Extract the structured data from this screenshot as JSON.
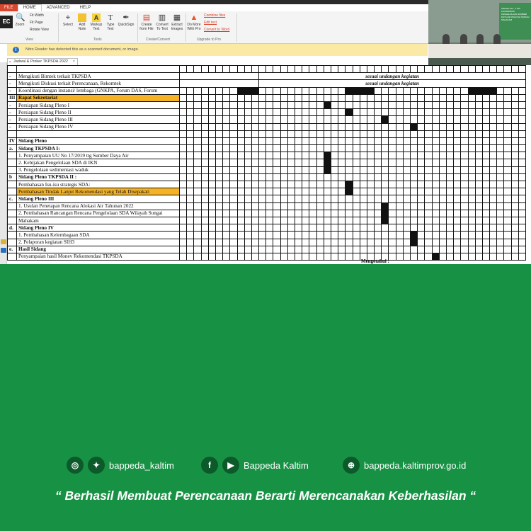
{
  "app": {
    "tabs": [
      "FILE",
      "HOME",
      "ADVANCED",
      "HELP"
    ],
    "ec_label": "EC",
    "ribbon": {
      "zoom_label": "Zoom",
      "fit_width": "Fit Width",
      "fit_page": "Fit Page",
      "rotate_view": "Rotate View",
      "view_group": "View",
      "select_label": "Select",
      "add_note": "Add Note",
      "markup_text": "Markup Text",
      "type_text": "Type Text",
      "quicksign": "QuickSign",
      "tools_group": "Tools",
      "create_from_file": "Create from File",
      "convert_to_text": "Convert To Text",
      "extract_images": "Extract Images",
      "create_convert_group": "Create/Convert",
      "do_more_with_pro": "Do More With Pro",
      "combine_files": "Combine files",
      "edit_text": "Edit text",
      "convert_to_word": "Convert to Word",
      "upgrade_group": "Upgrade to Pro"
    },
    "notice": "Nitro Reader has detected this as a scanned document, or image.",
    "document_tab": "Jadwal & Proker TKPSDA 2022",
    "video_banner": "SIDANG KE - II TIM KOORDINASI PENGELOLAAN SUMBER DAYA AIR WILAYAH SUNGAI MAHAKAM"
  },
  "schedule": {
    "rows": [
      {
        "num": "",
        "text": "",
        "fills": [],
        "note": "",
        "style": ""
      },
      {
        "num": "-",
        "text": "Mengikuti Bimtek terkait TKPSDA",
        "fills": [],
        "note": "sesuai undangan kegiatan",
        "style": ""
      },
      {
        "num": "-",
        "text": "Mengikuti Diskusi terkait Perencanaan, Rekomtek",
        "fills": [],
        "note": "sesuai undangan kegiatan",
        "style": ""
      },
      {
        "num": "-",
        "text": "Koordinasi dengan instansi/ lembaga (GNKPA, Forum DAS, Forum",
        "fills": [
          8,
          9,
          10,
          23,
          24,
          25,
          26,
          40,
          41,
          42,
          43
        ],
        "note": "",
        "style": ""
      },
      {
        "num": "III",
        "text": "Rapat Sekretariat",
        "fills": [],
        "note": "",
        "style": "hl sec"
      },
      {
        "num": "-",
        "text": "Persiapan Sidang Pleno I",
        "fills": [
          20
        ],
        "note": "",
        "style": ""
      },
      {
        "num": "-",
        "text": "Persiapan Sidang Pleno II",
        "fills": [
          23
        ],
        "note": "",
        "style": ""
      },
      {
        "num": "-",
        "text": "Persiapan Sidang Pleno III",
        "fills": [
          28
        ],
        "note": "",
        "style": ""
      },
      {
        "num": "-",
        "text": "Persiapan Sidang Pleno IV",
        "fills": [
          32
        ],
        "note": "",
        "style": ""
      },
      {
        "num": "",
        "text": "",
        "fills": [],
        "note": "",
        "style": ""
      },
      {
        "num": "IV",
        "text": "Sidang Pleno",
        "fills": [],
        "note": "",
        "style": "sec"
      },
      {
        "num": "a.",
        "text": "Sidang TKPSDA I:",
        "fills": [],
        "note": "",
        "style": "sec"
      },
      {
        "num": "",
        "text": "1. Penyampaian UU No 17/2019 ttg Sumber Daya Air",
        "fills": [
          20
        ],
        "note": "",
        "style": ""
      },
      {
        "num": "",
        "text": "2. Kebijakan Pengelolaan SDA di IKN",
        "fills": [
          20
        ],
        "note": "",
        "style": ""
      },
      {
        "num": "",
        "text": "3. Pengelolaan sedimentasi waduk",
        "fills": [
          20
        ],
        "note": "",
        "style": ""
      },
      {
        "num": "b",
        "text": "Sidang Pleno TKPSDA II :",
        "fills": [],
        "note": "",
        "style": "sec"
      },
      {
        "num": "",
        "text": "Pembahasan Isu-isu strategis SDA:",
        "fills": [
          23
        ],
        "note": "",
        "style": ""
      },
      {
        "num": "",
        "text": "Pembahasan Tindak Lanjut Rekomendasi yang Telah Disepakati",
        "fills": [
          23
        ],
        "note": "",
        "style": "hl"
      },
      {
        "num": "c.",
        "text": "Sidang Pleno III",
        "fills": [],
        "note": "",
        "style": "sec"
      },
      {
        "num": "",
        "text": "1. Usulan Penetapan Rencana Alokasi Air Tahunan 2022",
        "fills": [
          28
        ],
        "note": "",
        "style": ""
      },
      {
        "num": "",
        "text": "2. Pembahasan Rancangan Rencana Pengelolaan SDA Wilayah Sungai",
        "fills": [
          28
        ],
        "note": "",
        "style": ""
      },
      {
        "num": "",
        "text": "Mahakam",
        "fills": [
          28
        ],
        "note": "",
        "style": ""
      },
      {
        "num": "d.",
        "text": "Sidang Pleno IV",
        "fills": [],
        "note": "",
        "style": "sec"
      },
      {
        "num": "",
        "text": "1. Pembahasan Kelembagaan SDA",
        "fills": [
          32
        ],
        "note": "",
        "style": ""
      },
      {
        "num": "",
        "text": "2. Pelaporan kegiatan SIH3",
        "fills": [
          32
        ],
        "note": "",
        "style": ""
      },
      {
        "num": "e.",
        "text": "Hasil Sidang",
        "fills": [],
        "note": "",
        "style": "sec"
      },
      {
        "num": "",
        "text": "Penyampaian hasil Monev Rekomendasi TKPSDA",
        "fills": [
          35
        ],
        "note": "",
        "style": ""
      }
    ],
    "columns": 48,
    "signature_label": "Mengetahui :"
  },
  "footer": {
    "instagram_handle": "bappeda_kaltim",
    "facebook_name": "Bappeda Kaltim",
    "website": "bappeda.kaltimprov.go.id",
    "slogan": "“ Berhasil  Membuat Perencanaan Berarti Merencanakan Keberhasilan “"
  },
  "colors": {
    "brand_green": "#179245",
    "highlight_orange": "#f5b224",
    "file_tab_red": "#d8462d"
  }
}
